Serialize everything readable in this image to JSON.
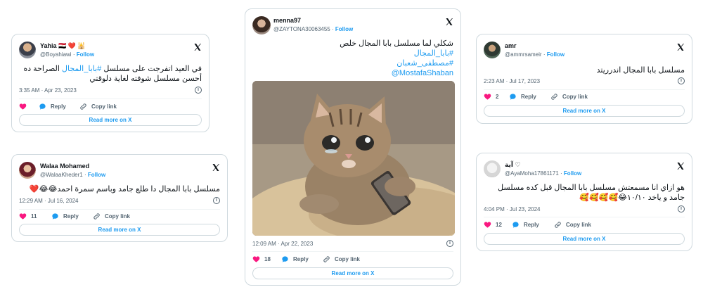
{
  "colors": {
    "accent": "#1d9bf0",
    "like": "#f91880",
    "border": "#cfd9de",
    "muted": "#536471"
  },
  "icons": {
    "logo": "x-logo-icon",
    "like": "heart-icon",
    "reply": "reply-bubble-icon",
    "copy": "link-icon",
    "info": "info-icon"
  },
  "common": {
    "follow": "Follow",
    "reply": "Reply",
    "copy_link": "Copy link",
    "read_more": "Read more on X"
  },
  "tweets": [
    {
      "name": "Yahia 🇪🇬 ❤️ 🕌",
      "handle": "@Boyahiawi",
      "dot": "·",
      "text_prefix": "في العيد اتفرجت على مسلسل ",
      "hashtag": "#بابا_المجال",
      "text_suffix": " الصراحة ده أحسن مسلسل شوفته لغاية دلوقتي",
      "time": "3:35 AM · Apr 23, 2023",
      "likes": ""
    },
    {
      "name": "Walaa Mohamed",
      "handle": "@WalaaKheder1",
      "dot": "·",
      "text": "مسلسل بابا المجال دا طلع جامد وباسم سمرة احمد😂😂❤️",
      "time": "12:29 AM · Jul 16, 2024",
      "likes": "11"
    },
    {
      "name": "menna97",
      "handle": "@ZAYTONA30063455",
      "dot": "·",
      "lines": [
        "شكلي لما مسلسل بابا المجال خلص",
        "#بابا_المجال",
        "#مصطفى_شعبان",
        "@MostafaShaban"
      ],
      "time": "12:09 AM · Apr 22, 2023",
      "likes": "18"
    },
    {
      "name": "amr",
      "handle": "@ammrsameir",
      "dot": "·",
      "text": "مسلسل بابا المجال اندرريتد",
      "time": "2:23 AM · Jul 17, 2023",
      "likes": "2"
    },
    {
      "name": "آية ♡",
      "handle": "@AyaMoha17861171",
      "dot": "·",
      "text": "هو ازاي انا مسمعتش مسلسل بابا المجال قبل كده مسلسل جامد و ياخد ١٠/١٠😂🥰🥰🥰🥰",
      "time": "4:04 PM · Jul 23, 2024",
      "likes": "12"
    }
  ]
}
